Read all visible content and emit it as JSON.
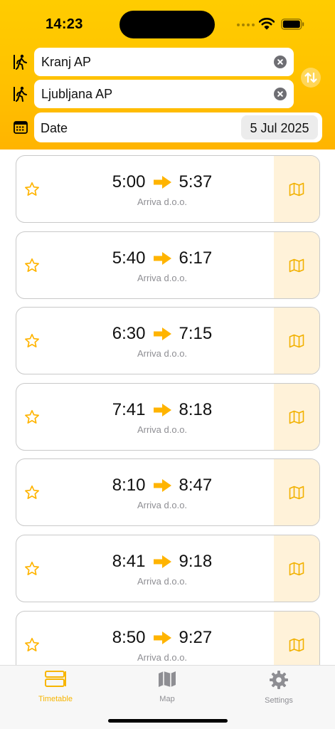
{
  "status_bar": {
    "time": "14:23"
  },
  "search": {
    "from": {
      "value": "Kranj AP"
    },
    "to": {
      "value": "Ljubljana AP"
    },
    "date": {
      "label": "Date",
      "value": "5 Jul 2025"
    }
  },
  "colors": {
    "accent": "#ffb400",
    "header": "#ffc400",
    "map_cell": "#fff2d9"
  },
  "departures": [
    {
      "depart": "5:00",
      "arrive": "5:37",
      "operator": "Arriva d.o.o."
    },
    {
      "depart": "5:40",
      "arrive": "6:17",
      "operator": "Arriva d.o.o."
    },
    {
      "depart": "6:30",
      "arrive": "7:15",
      "operator": "Arriva d.o.o."
    },
    {
      "depart": "7:41",
      "arrive": "8:18",
      "operator": "Arriva d.o.o."
    },
    {
      "depart": "8:10",
      "arrive": "8:47",
      "operator": "Arriva d.o.o."
    },
    {
      "depart": "8:41",
      "arrive": "9:18",
      "operator": "Arriva d.o.o."
    },
    {
      "depart": "8:50",
      "arrive": "9:27",
      "operator": "Arriva d.o.o."
    }
  ],
  "tabbar": {
    "items": [
      {
        "label": "Timetable",
        "icon": "timetable-icon",
        "active": true
      },
      {
        "label": "Map",
        "icon": "map-icon",
        "active": false
      },
      {
        "label": "Settings",
        "icon": "gear-icon",
        "active": false
      }
    ]
  }
}
